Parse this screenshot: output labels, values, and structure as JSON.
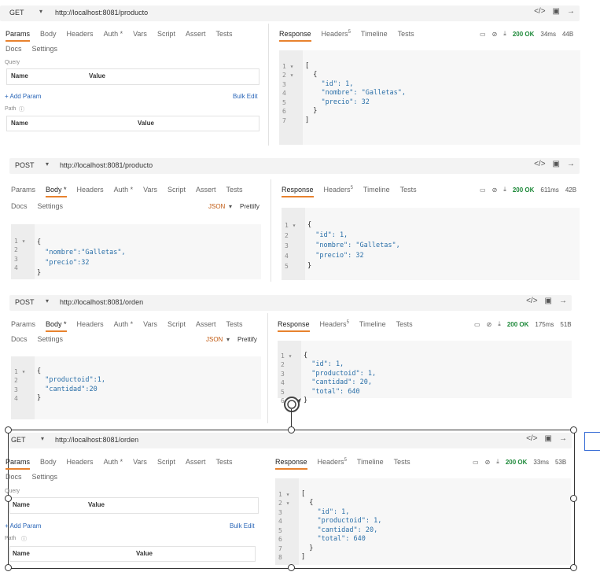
{
  "icons": [
    "code-icon",
    "save-icon",
    "send-icon",
    "layout-icon",
    "clear-icon",
    "download-icon",
    "help-icon",
    "chevron-down-icon",
    "fold-icon",
    "loading-icon"
  ],
  "colors": {
    "accent": "#e8822e",
    "ok": "#1f8a3b",
    "string": "#b5302a",
    "key": "#2a6fa8"
  },
  "req1": {
    "method": "GET",
    "url": "http://localhost:8081/producto",
    "tabs": [
      "Params",
      "Body",
      "Headers",
      "Auth *",
      "Vars",
      "Script",
      "Assert",
      "Tests"
    ],
    "tabs2": [
      "Docs",
      "Settings"
    ],
    "query_label": "Query",
    "name_col": "Name",
    "value_col": "Value",
    "add_param": "+ Add Param",
    "bulk_edit": "Bulk Edit",
    "path_label": "Path",
    "resp_tabs": [
      "Response",
      "Headers",
      "Timeline",
      "Tests"
    ],
    "headers_count": "5",
    "status": "200 OK",
    "time": "34ms",
    "size": "44B",
    "line_numbers": [
      "1",
      "2",
      "3",
      "4",
      "5",
      "6",
      "7"
    ],
    "response_code": [
      "[",
      "  {",
      "    \"id\": 1,",
      "    \"nombre\": \"Galletas\",",
      "    \"precio\": 32",
      "  }",
      "]"
    ]
  },
  "req2": {
    "method": "POST",
    "url": "http://localhost:8081/producto",
    "tabs": [
      "Params",
      "Body *",
      "Headers",
      "Auth *",
      "Vars",
      "Script",
      "Assert",
      "Tests"
    ],
    "tabs2": [
      "Docs",
      "Settings"
    ],
    "body_type": "JSON",
    "prettify": "Prettify",
    "body_line_numbers": [
      "1",
      "2",
      "3",
      "4"
    ],
    "body_code": [
      "{",
      "  \"nombre\":\"Galletas\",",
      "  \"precio\":32",
      "}"
    ],
    "resp_tabs": [
      "Response",
      "Headers",
      "Timeline",
      "Tests"
    ],
    "headers_count": "5",
    "status": "200 OK",
    "time": "611ms",
    "size": "42B",
    "line_numbers": [
      "1",
      "2",
      "3",
      "4",
      "5"
    ],
    "response_code": [
      "{",
      "  \"id\": 1,",
      "  \"nombre\": \"Galletas\",",
      "  \"precio\": 32",
      "}"
    ]
  },
  "req3": {
    "method": "POST",
    "url": "http://localhost:8081/orden",
    "tabs": [
      "Params",
      "Body *",
      "Headers",
      "Auth *",
      "Vars",
      "Script",
      "Assert",
      "Tests"
    ],
    "tabs2": [
      "Docs",
      "Settings"
    ],
    "body_type": "JSON",
    "prettify": "Prettify",
    "body_line_numbers": [
      "1",
      "2",
      "3",
      "4"
    ],
    "body_code": [
      "{",
      "  \"productoid\":1,",
      "  \"cantidad\":20",
      "}"
    ],
    "resp_tabs": [
      "Response",
      "Headers",
      "Timeline",
      "Tests"
    ],
    "headers_count": "5",
    "status": "200 OK",
    "time": "175ms",
    "size": "51B",
    "line_numbers": [
      "1",
      "2",
      "3",
      "4",
      "5",
      "6"
    ],
    "response_code": [
      "{",
      "  \"id\": 1,",
      "  \"productoid\": 1,",
      "  \"cantidad\": 20,",
      "  \"total\": 640",
      "}"
    ]
  },
  "req4": {
    "method": "GET",
    "url": "http://localhost:8081/orden",
    "tabs": [
      "Params",
      "Body",
      "Headers",
      "Auth *",
      "Vars",
      "Script",
      "Assert",
      "Tests"
    ],
    "tabs2": [
      "Docs",
      "Settings"
    ],
    "query_label": "Query",
    "name_col": "Name",
    "value_col": "Value",
    "add_param": "+ Add Param",
    "bulk_edit": "Bulk Edit",
    "path_label": "Path",
    "resp_tabs": [
      "Response",
      "Headers",
      "Timeline",
      "Tests"
    ],
    "headers_count": "5",
    "status": "200 OK",
    "time": "33ms",
    "size": "53B",
    "line_numbers": [
      "1",
      "2",
      "3",
      "4",
      "5",
      "6",
      "7",
      "8"
    ],
    "response_code": [
      "[",
      "  {",
      "    \"id\": 1,",
      "    \"productoid\": 1,",
      "    \"cantidad\": 20,",
      "    \"total\": 640",
      "  }",
      "]"
    ]
  }
}
